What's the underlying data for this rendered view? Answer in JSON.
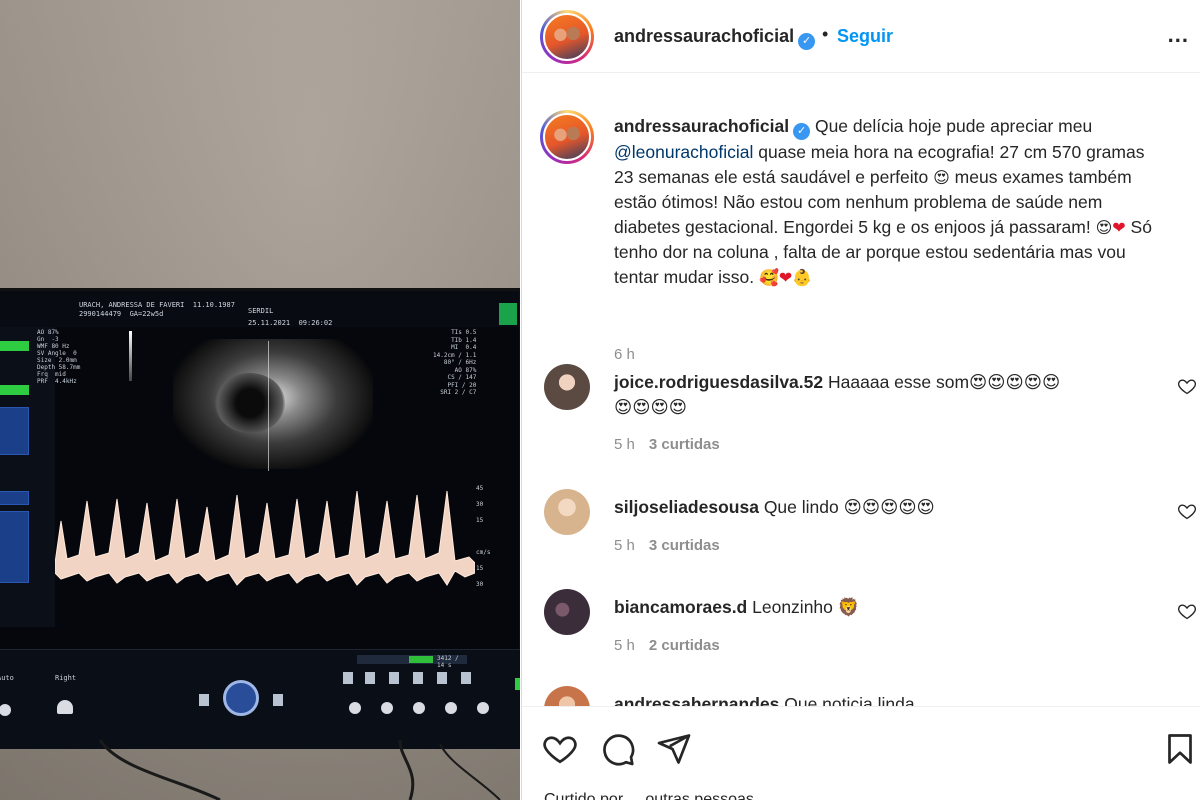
{
  "media": {
    "monitor": {
      "patient_line1": "URACH, ANDRESSA DE FAVERI  11.10.1987",
      "patient_line2": "2990144479  GA=22w5d",
      "date": "25.11.2021",
      "time": "09:26:02",
      "operator": "SERDIL",
      "left_params": "AO 87%\nGn  -3\nWMF 80 Hz\nSV Angle  0\nSize  2.0mm\nDepth 58.7mm\nFrq  mid\nPRF  4.4kHz",
      "right_params": "TIs 0.5\nTIb 1.4\nMI  0.4\n14.2cm / 1.1\n80° / 6Hz\nAO 87%\nCS / 147\nPFI / 20\nSRI 2 / C7",
      "doppler_scale": "45\n30\n15\n\ncm/s\n15\n30",
      "progress_label": "3412 / 14 s",
      "ctrl_left": "Auto",
      "ctrl_right": "Right"
    }
  },
  "header": {
    "username": "andressaurachoficial",
    "verified": "✓",
    "separator": "•",
    "follow_label": "Seguir",
    "more": "..."
  },
  "caption": {
    "username": "andressaurachoficial",
    "verified": "✓",
    "text_a": "Que delícia hoje pude apreciar meu",
    "mention": "@leonurachoficial",
    "text_b": "quase meia hora na ecografia! 27 cm 570 gramas 23 semanas ele está saudável e perfeito",
    "emoji_1": "😍",
    "text_c": "meus exames também estão ótimos! Não estou com nenhum problema de saúde nem diabetes gestacional. Engordei 5 kg e os enjoos já passaram!",
    "emoji_2": "😍",
    "emoji_3": "❤",
    "text_d": "Só tenho dor na coluna , falta de ar porque estou sedentária mas vou tentar mudar isso.",
    "emoji_4": "🥰",
    "emoji_5": "❤",
    "emoji_6": "👶",
    "time": "6 h"
  },
  "comments": [
    {
      "username": "joice.rodriguesdasilva.52",
      "text": "Haaaaa esse som😍😍😍😍😍😍😍😍😍",
      "time": "5 h",
      "likes": "3 curtidas",
      "avatar_color": "#5a4a42"
    },
    {
      "username": "siljoseliadesousa",
      "text": "Que lindo 😍😍😍😍😍",
      "time": "5 h",
      "likes": "3 curtidas",
      "avatar_color": "#d8b48e"
    },
    {
      "username": "biancamoraes.d",
      "text": "Leonzinho 🦁",
      "time": "5 h",
      "likes": "2 curtidas",
      "avatar_color": "#3b2d3a"
    },
    {
      "username": "andressahernandes",
      "text": "Que noticia linda",
      "time": "",
      "likes": "",
      "avatar_color": "#c7744a"
    }
  ],
  "actions": {
    "like_icon": "heart-outline",
    "comment_icon": "comment-bubble",
    "share_icon": "paper-plane",
    "save_icon": "bookmark",
    "likes_text": "Curtido por ... outras pessoas"
  },
  "colors": {
    "accent": "#0095f6",
    "mention": "#00376b",
    "meta": "#8e8e8e",
    "text": "#262626"
  }
}
